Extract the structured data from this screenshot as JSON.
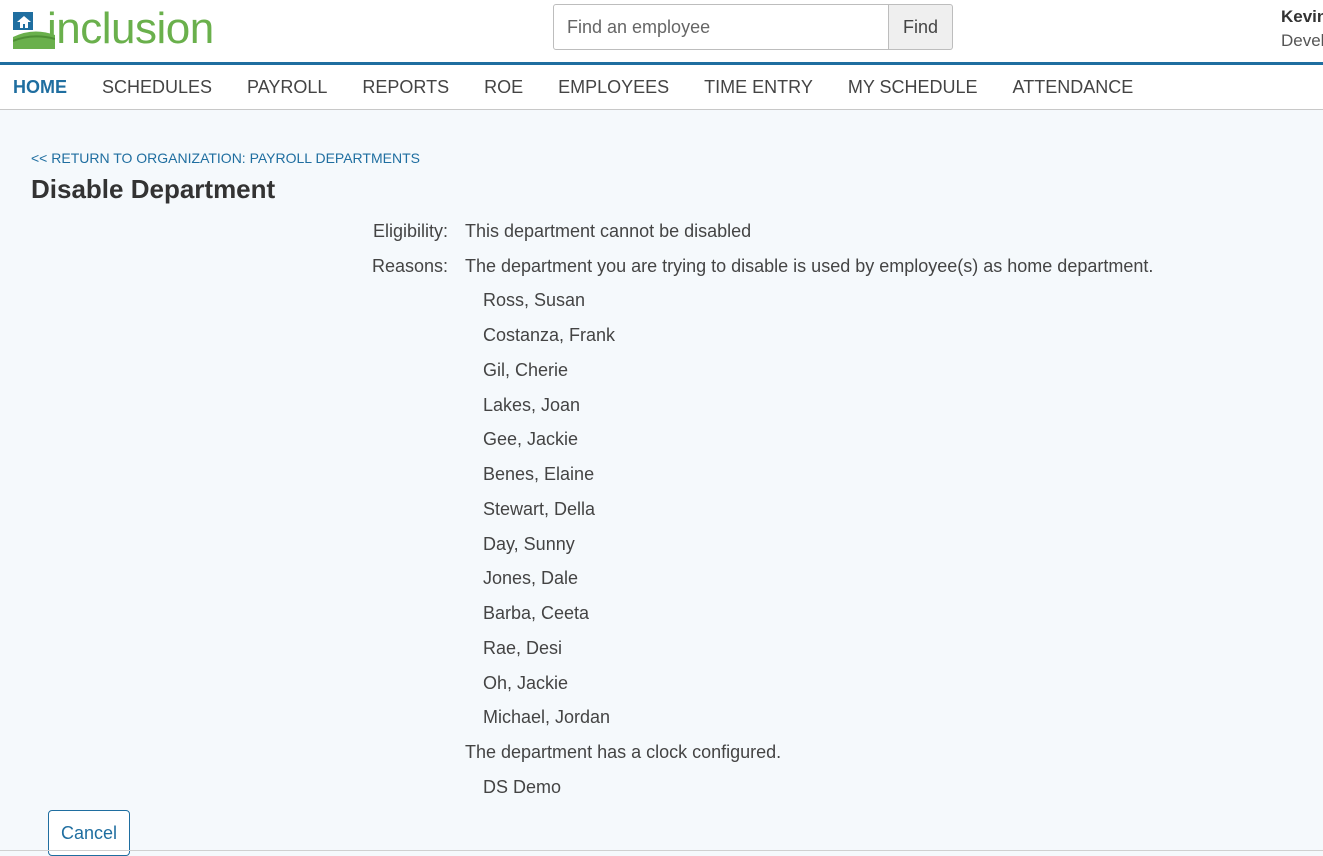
{
  "header": {
    "logo_text": "inclusion",
    "search_placeholder": "Find an employee",
    "find_label": "Find",
    "user_name": "Kevin",
    "user_role": "Developer"
  },
  "nav": {
    "items": [
      {
        "label": "HOME",
        "active": true
      },
      {
        "label": "SCHEDULES"
      },
      {
        "label": "PAYROLL"
      },
      {
        "label": "REPORTS"
      },
      {
        "label": "ROE"
      },
      {
        "label": "EMPLOYEES"
      },
      {
        "label": "TIME ENTRY"
      },
      {
        "label": "MY SCHEDULE"
      },
      {
        "label": "ATTENDANCE"
      }
    ]
  },
  "page": {
    "return_link": "<< RETURN TO ORGANIZATION: PAYROLL DEPARTMENTS",
    "title": "Disable Department",
    "eligibility_label": "Eligibility:",
    "eligibility_value": "This department cannot be disabled",
    "reasons_label": "Reasons:",
    "reason_1": "The department you are trying to disable is used by employee(s) as home department.",
    "employees": [
      "Ross, Susan",
      "Costanza, Frank",
      "Gil, Cherie",
      "Lakes, Joan",
      "Gee, Jackie",
      "Benes, Elaine",
      "Stewart, Della",
      "Day, Sunny",
      "Jones, Dale",
      "Barba, Ceeta",
      "Rae, Desi",
      "Oh, Jackie",
      "Michael, Jordan"
    ],
    "reason_2": "The department has a clock configured.",
    "clocks": [
      "DS Demo"
    ],
    "cancel_label": "Cancel"
  }
}
